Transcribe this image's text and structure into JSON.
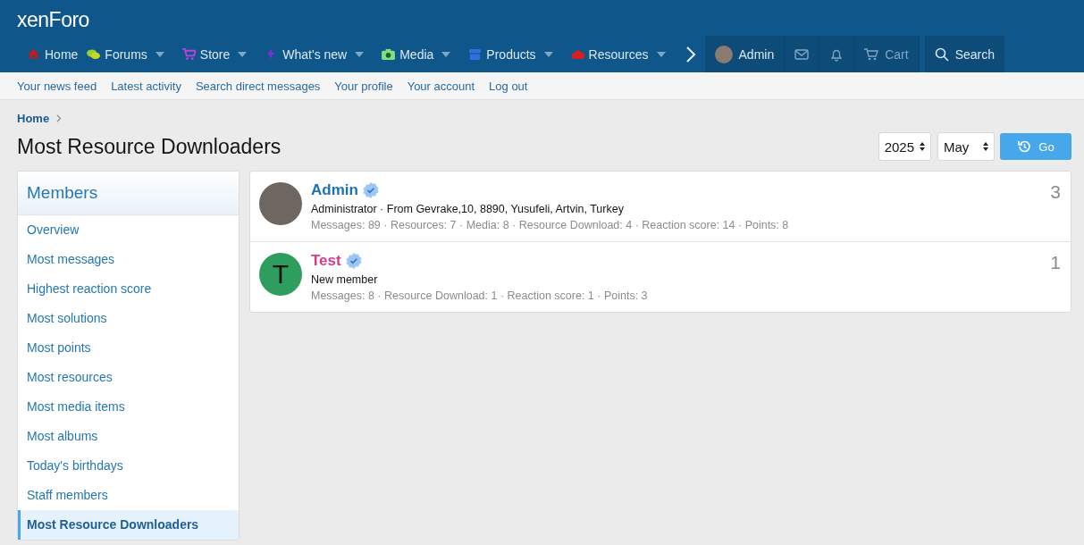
{
  "header": {
    "logo": "xenForo"
  },
  "nav": [
    {
      "label": "Home",
      "kind": "house",
      "dropdown": false
    },
    {
      "label": "Forums",
      "kind": "chat",
      "dropdown": true
    },
    {
      "label": "Store",
      "kind": "cart",
      "dropdown": true
    },
    {
      "label": "What's new",
      "kind": "bolt",
      "dropdown": true
    },
    {
      "label": "Media",
      "kind": "camera",
      "dropdown": true
    },
    {
      "label": "Products",
      "kind": "shop",
      "dropdown": true
    },
    {
      "label": "Resources",
      "kind": "cloud",
      "dropdown": true
    }
  ],
  "account": {
    "username": "Admin",
    "cart": "Cart",
    "search": "Search"
  },
  "subnav": [
    "Your news feed",
    "Latest activity",
    "Search direct messages",
    "Your profile",
    "Your account",
    "Log out"
  ],
  "breadcrumb": [
    "Home"
  ],
  "page_title": "Most Resource Downloaders",
  "filters": {
    "year": "2025",
    "month": "May",
    "go": "Go"
  },
  "sidebar": {
    "title": "Members",
    "items": [
      {
        "label": "Overview",
        "selected": false
      },
      {
        "label": "Most messages",
        "selected": false
      },
      {
        "label": "Highest reaction score",
        "selected": false
      },
      {
        "label": "Most solutions",
        "selected": false
      },
      {
        "label": "Most points",
        "selected": false
      },
      {
        "label": "Most resources",
        "selected": false
      },
      {
        "label": "Most media items",
        "selected": false
      },
      {
        "label": "Most albums",
        "selected": false
      },
      {
        "label": "Today's birthdays",
        "selected": false
      },
      {
        "label": "Staff members",
        "selected": false
      },
      {
        "label": "Most Resource Downloaders",
        "selected": true
      }
    ]
  },
  "members": [
    {
      "name": "Admin",
      "color": "#1a73b8",
      "title": "Administrator · From Gevrake,10, 8890, Yusufeli, Artvin, Turkey",
      "stats": "Messages: 89 · Resources: 7 · Media: 8 · Resource Download: 4 · Reaction score: 14 · Points: 8",
      "count": "3"
    },
    {
      "name": "Test",
      "avatar": {
        "letter": "T",
        "color": "#2e9e5e"
      },
      "color": "#d63a86",
      "title": "New member",
      "stats": "Messages: 8 · Resource Download: 1 · Reaction score: 1 · Points: 3",
      "count": "1"
    }
  ]
}
